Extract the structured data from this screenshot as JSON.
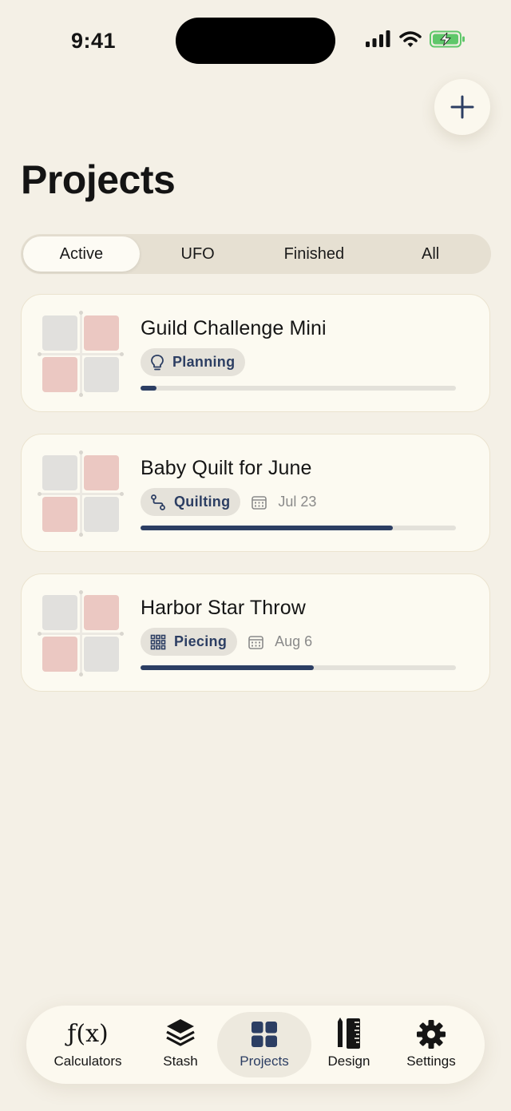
{
  "status": {
    "time": "9:41"
  },
  "header": {
    "title": "Projects"
  },
  "segments": [
    {
      "label": "Active",
      "selected": true
    },
    {
      "label": "UFO",
      "selected": false
    },
    {
      "label": "Finished",
      "selected": false
    },
    {
      "label": "All",
      "selected": false
    }
  ],
  "projects": [
    {
      "title": "Guild Challenge Mini",
      "stage": "Planning",
      "stage_icon": "lightbulb-icon",
      "date": "",
      "progress": 0.05
    },
    {
      "title": "Baby Quilt for June",
      "stage": "Quilting",
      "stage_icon": "quilting-path-icon",
      "date": "Jul 23",
      "progress": 0.8
    },
    {
      "title": "Harbor Star Throw",
      "stage": "Piecing",
      "stage_icon": "grid-icon",
      "date": "Aug 6",
      "progress": 0.55
    }
  ],
  "tabs": [
    {
      "label": "Calculators",
      "icon": "function-icon",
      "glyph": "ƒ(x)",
      "active": false
    },
    {
      "label": "Stash",
      "icon": "layers-icon",
      "active": false
    },
    {
      "label": "Projects",
      "icon": "grid-icon",
      "active": true
    },
    {
      "label": "Design",
      "icon": "pencil-ruler-icon",
      "active": false
    },
    {
      "label": "Settings",
      "icon": "gear-icon",
      "active": false
    }
  ],
  "colors": {
    "accent": "#2c3e63",
    "background": "#f4f0e6",
    "card": "#fcfaf1",
    "pink": "#ebc8c2",
    "gray": "#e1e0dd"
  }
}
